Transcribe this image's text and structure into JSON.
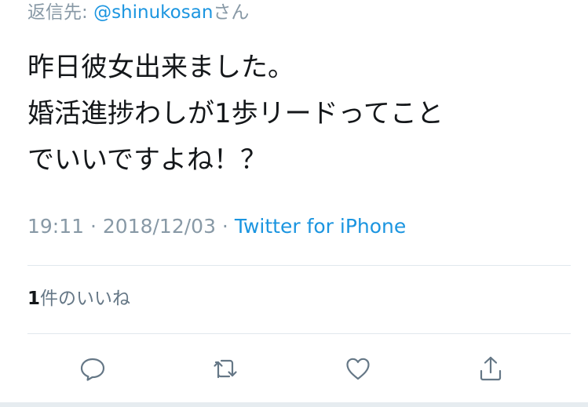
{
  "reply": {
    "prefix": "返信先: ",
    "handle": "@shinukosan",
    "suffix": "さん"
  },
  "tweet": {
    "lines": [
      "昨日彼女出来ました。",
      "婚活進捗わしが1歩リードってこと",
      "でいいですよね！？"
    ]
  },
  "meta": {
    "time": "19:11",
    "separator": " · ",
    "date": "2018/12/03",
    "source": "Twitter for iPhone"
  },
  "likes": {
    "count": "1",
    "label": "件のいいね"
  },
  "actions": [
    {
      "name": "reply",
      "icon": "reply-icon"
    },
    {
      "name": "retweet",
      "icon": "retweet-icon"
    },
    {
      "name": "like",
      "icon": "heart-icon"
    },
    {
      "name": "share",
      "icon": "share-icon"
    }
  ],
  "colors": {
    "text": "#14171a",
    "muted": "#8899a6",
    "link": "#1b95e0",
    "divider": "#e1e8ed",
    "icon": "#657786"
  }
}
